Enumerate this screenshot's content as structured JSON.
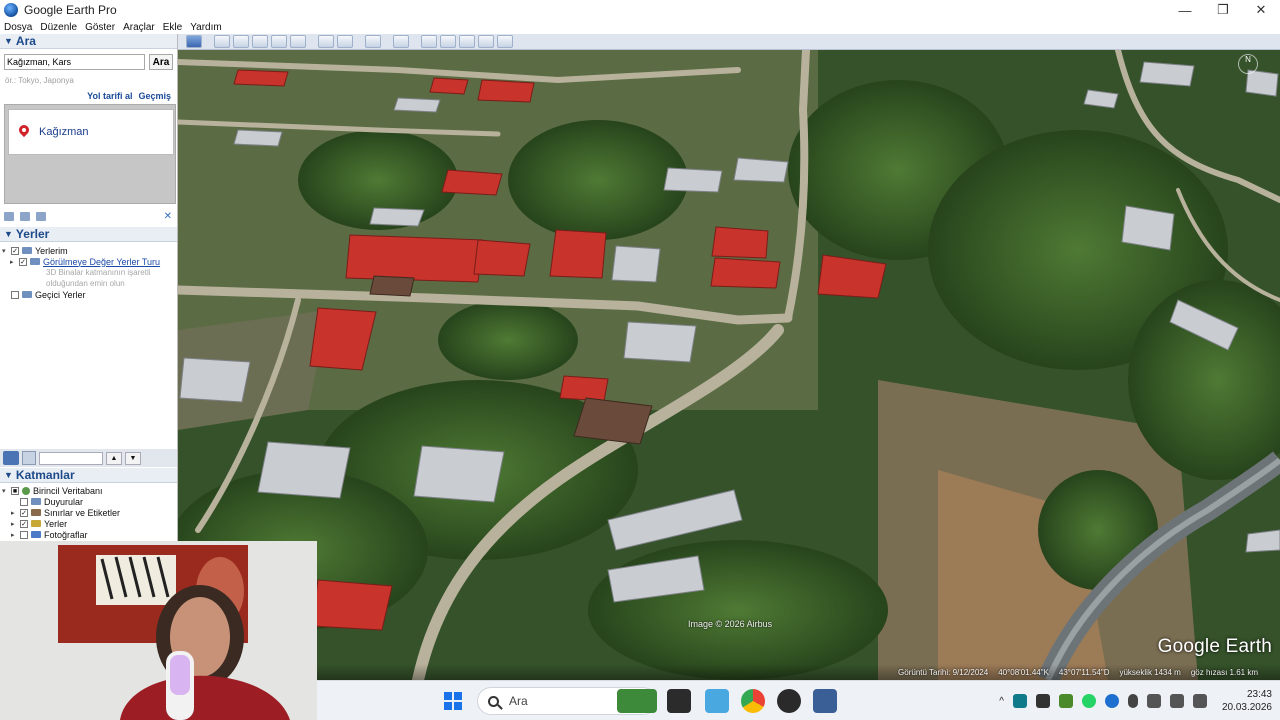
{
  "window": {
    "title": "Google Earth Pro",
    "minimize": "—",
    "maximize": "❐",
    "close": "✕"
  },
  "menu": [
    "Dosya",
    "Düzenle",
    "Göster",
    "Araçlar",
    "Ekle",
    "Yardım"
  ],
  "search": {
    "header": "Ara",
    "query": "Kağızman, Kars",
    "button": "Ara",
    "hint": "ör.: Tokyo, Japonya",
    "link_directions": "Yol tarifi al",
    "link_history": "Geçmiş",
    "result": "Kağızman"
  },
  "places": {
    "header": "Yerler",
    "items": [
      {
        "label": "Yerlerim",
        "checked": true
      },
      {
        "label": "Görülmeye Değer Yerler Turu",
        "checked": true,
        "link": true
      },
      {
        "label": "Geçici Yerler",
        "checked": false
      }
    ],
    "note_line1": "3D Binalar katmanının işaretli",
    "note_line2": "olduğundan emin olun"
  },
  "layers": {
    "header": "Katmanlar",
    "items": [
      {
        "label": "Birincil Veritabanı"
      },
      {
        "label": "Duyurular"
      },
      {
        "label": "Sınırlar ve Etiketler"
      },
      {
        "label": "Yerler"
      },
      {
        "label": "Fotoğraflar"
      }
    ]
  },
  "map": {
    "credit": "Image © 2026 Airbus",
    "logo": "Google Earth",
    "compass_n": "N",
    "status": {
      "imagery_date": "Görüntü Tarihi: 9/12/2024",
      "lat": "40°08'01.44\"K",
      "lon": "43°07'11.54\"D",
      "elevation": "yükseklik 1434 m",
      "eye_alt": "göz hızası 1.61 km"
    }
  },
  "taskbar": {
    "search_placeholder": "Ara",
    "time": "23:43",
    "date": "20.03.2026"
  }
}
